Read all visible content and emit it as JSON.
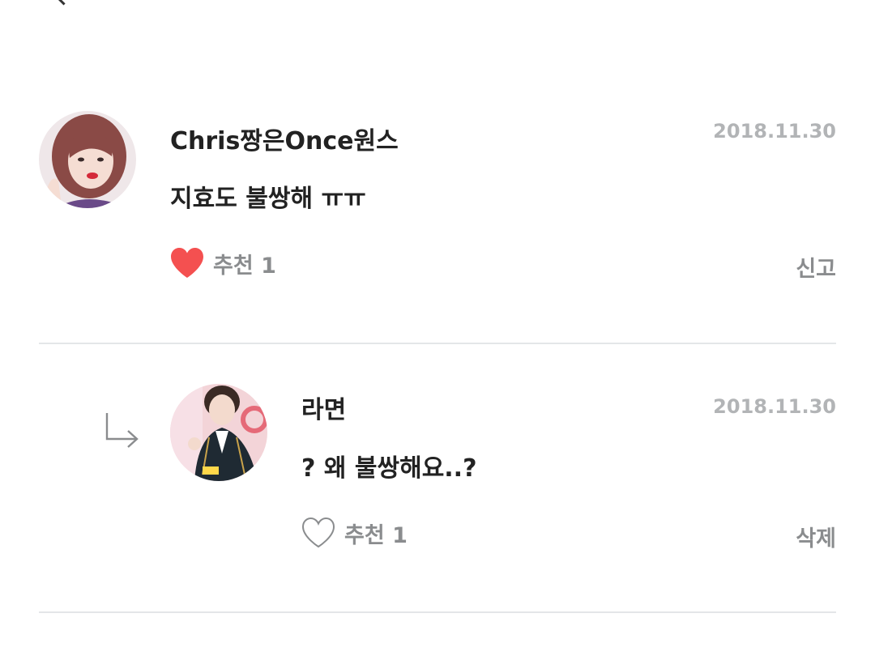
{
  "comments": [
    {
      "username": "Chris짱은Once원스",
      "date": "2018.11.30",
      "text": "지효도 불쌍해 ㅠㅠ",
      "like_label": "추천 1",
      "liked": true,
      "action_label": "신고"
    },
    {
      "username": "라면",
      "date": "2018.11.30",
      "text": "? 왜 불쌍해요..?",
      "like_label": "추천 1",
      "liked": false,
      "action_label": "삭제"
    }
  ],
  "colors": {
    "heart_filled": "#f45050",
    "heart_outline": "#8a8c8e",
    "muted_text": "#8a8c8e",
    "date_text": "#b2b4b6",
    "divider": "#e4e6e8"
  },
  "icons": {
    "liked": "heart-filled-icon",
    "unliked": "heart-outline-icon",
    "reply": "reply-arrow-icon"
  }
}
